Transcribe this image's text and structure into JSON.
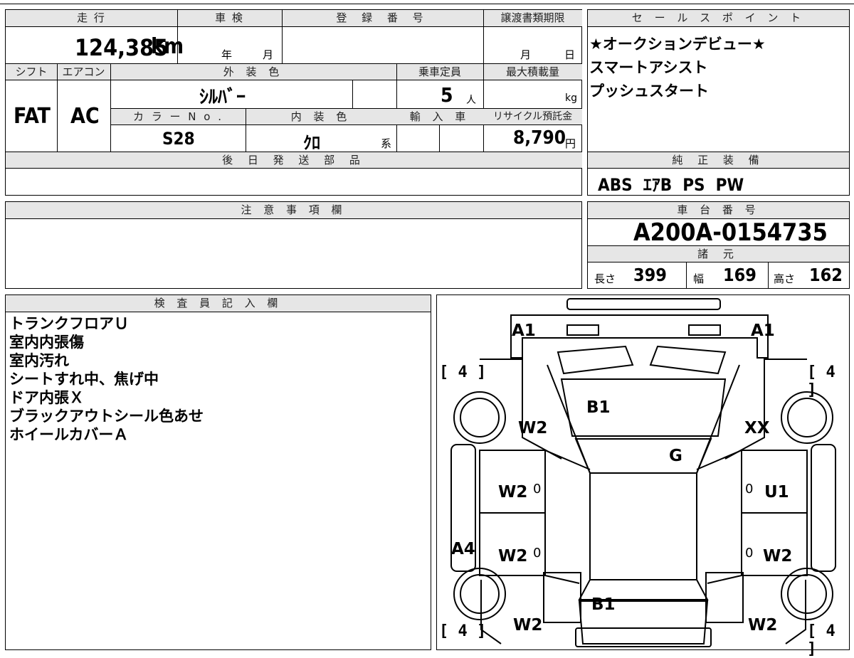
{
  "vehicle": {
    "headers": {
      "mileage": "走 行",
      "inspection": "車 検",
      "registration": "登 録 番 号",
      "transfer_deadline": "譲渡書類期限",
      "shift": "シフト",
      "aircon": "エアコン",
      "exterior_color": "外 装 色",
      "capacity": "乗車定員",
      "max_load": "最大積載量",
      "color_no": "カ ラ ー N o .",
      "interior_color": "内 装 色",
      "import": "輸 入 車",
      "recycle": "リサイクル預託金",
      "later_parts": "後 日 発 送 部 品",
      "caution": "注 意 事 項 欄",
      "inspector": "検 査 員 記 入 欄"
    },
    "mileage": "124,385",
    "mileage_unit": "km",
    "inspection_year": "年",
    "inspection_month": "月",
    "transfer_month": "月",
    "transfer_day": "日",
    "shift": "FAT",
    "aircon": "AC",
    "exterior_color": "ｼﾙﾊﾞｰ",
    "capacity": "5",
    "capacity_unit": "人",
    "max_load_unit": "kg",
    "color_no": "S28",
    "interior_color": "ｸﾛ",
    "interior_suffix": "系",
    "recycle_fee": "8,790",
    "recycle_unit": "円"
  },
  "sales": {
    "header": "セ ー ル ス ポ イ ン ト",
    "lines": [
      "★オークションデビュー★",
      "スマートアシスト",
      "プッシュスタート"
    ]
  },
  "equipment": {
    "header": "純 正 装 備",
    "items": "ABS  ｴｱB  PS  PW"
  },
  "chassis": {
    "header": "車 台 番 号",
    "number": "A200A-0154735",
    "specs_header": "諸 元",
    "length_label": "長さ",
    "length": "399",
    "width_label": "幅",
    "width": "169",
    "height_label": "高さ",
    "height": "162"
  },
  "inspector_notes": [
    "トランクフロアＵ",
    "室内内張傷",
    "室内汚れ",
    "シートすれ中、焦げ中",
    "ドア内張Ｘ",
    "ブラックアウトシール色あせ",
    "ホイールカバーＡ"
  ],
  "diagram": {
    "marks": {
      "a1_left": "A1",
      "a1_right": "A1",
      "b1_front": "B1",
      "b1_rear": "B1",
      "g": "G",
      "xx": "XX",
      "u1": "U1",
      "a4": "A4",
      "w2_fl": "W2",
      "w2_fdl": "W2",
      "w2_rdl": "W2",
      "w2_rl": "W2",
      "w2_rdr": "W2",
      "w2_rr": "W2",
      "zero1": "0",
      "zero2": "0",
      "zero3": "0",
      "zero4": "0"
    },
    "tires": {
      "fl": "[ 4 ]",
      "fr": "[ 4 ]",
      "rl": "[ 4 ]",
      "rr": "[ 4 ]"
    }
  }
}
